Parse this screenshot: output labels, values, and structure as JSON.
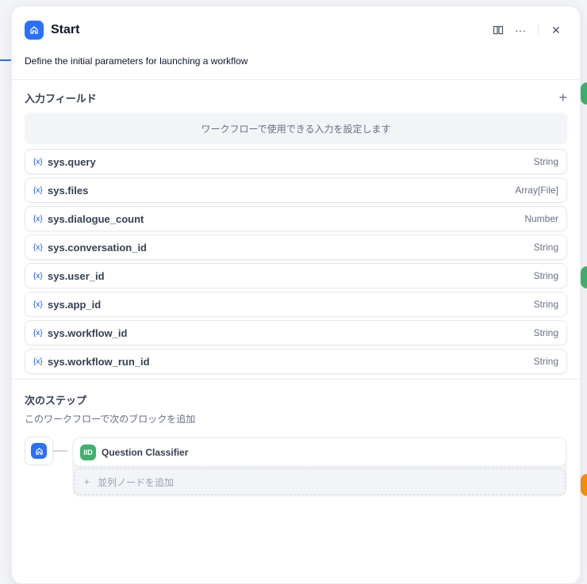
{
  "header": {
    "title": "Start",
    "description": "Define the initial parameters for launching a workflow"
  },
  "input_fields": {
    "title": "入力フィールド",
    "hint": "ワークフローで使用できる入力を設定します",
    "variables": [
      {
        "name": "sys.query",
        "type": "String"
      },
      {
        "name": "sys.files",
        "type": "Array[File]"
      },
      {
        "name": "sys.dialogue_count",
        "type": "Number"
      },
      {
        "name": "sys.conversation_id",
        "type": "String"
      },
      {
        "name": "sys.user_id",
        "type": "String"
      },
      {
        "name": "sys.app_id",
        "type": "String"
      },
      {
        "name": "sys.workflow_id",
        "type": "String"
      },
      {
        "name": "sys.workflow_run_id",
        "type": "String"
      }
    ]
  },
  "var_icon": "{x}",
  "next_step": {
    "title": "次のステップ",
    "subtitle": "このワークフローで次のブロックを追加",
    "node": "Question Classifier",
    "add_parallel": "並列ノードを追加",
    "plus": "+"
  },
  "colors": {
    "accent": "#2970ff",
    "classifier": "#3fb16c"
  }
}
